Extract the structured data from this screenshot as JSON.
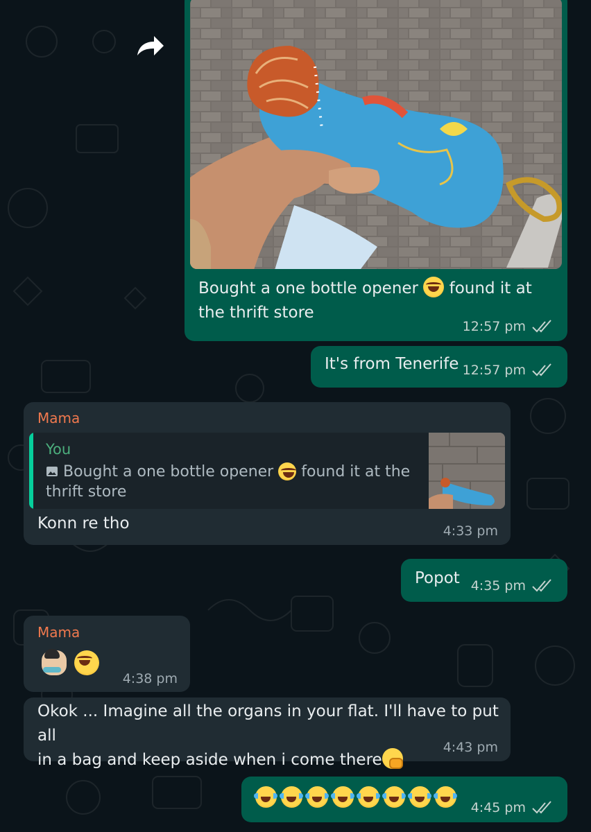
{
  "messages": {
    "m1": {
      "text_before": "Bought a one bottle opener",
      "text_after": "found it at the thrift store",
      "time": "12:57 pm",
      "emoji": "rolling-laughing-emoji"
    },
    "m2": {
      "text": "It's from Tenerife",
      "time": "12:57 pm"
    },
    "m3": {
      "sender": "Mama",
      "reply_author": "You",
      "reply_before": "Bought a one bottle opener",
      "reply_after": "found it at the thrift store",
      "text": "Konn re tho",
      "time": "4:33 pm"
    },
    "m4": {
      "text": "Popot",
      "time": "4:35 pm"
    },
    "m5": {
      "sender": "Mama",
      "time": "4:38 pm",
      "emojis": [
        "facepalm-emoji",
        "rolling-laughing-emoji"
      ]
    },
    "m6": {
      "text_line1": "Okok ... Imagine all the organs in your flat. I'll have to put all",
      "text_line2": "in a bag and keep aside when i come there",
      "time": "4:43 pm",
      "emoji": "hand-over-mouth-emoji"
    },
    "m7": {
      "time": "4:45 pm",
      "emoji_count": 8,
      "emoji": "crying-laughing-emoji"
    }
  },
  "colors": {
    "outgoing": "#005c4b",
    "incoming": "#202c33",
    "background": "#0b141a",
    "sender_name": "#f0794e",
    "reply_author": "#4caf7d"
  }
}
